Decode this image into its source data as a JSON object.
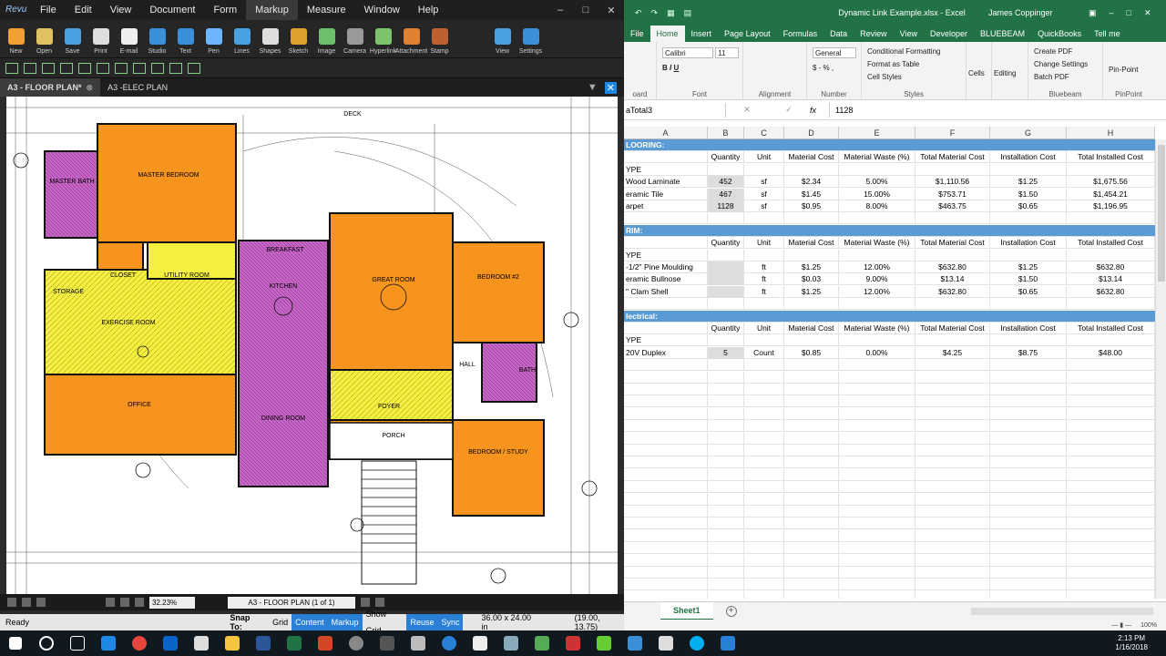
{
  "bluebeam": {
    "menu": [
      "File",
      "Edit",
      "View",
      "Document",
      "Form",
      "Markup",
      "Measure",
      "Window",
      "Help"
    ],
    "active_menu": "Markup",
    "logo": "Revu",
    "tools": [
      {
        "label": "New",
        "color": "#f0a030"
      },
      {
        "label": "Open",
        "color": "#e0c060"
      },
      {
        "label": "Save",
        "color": "#4aa0e0"
      },
      {
        "label": "Print",
        "color": "#dddddd"
      },
      {
        "label": "E-mail",
        "color": "#eeeeee"
      },
      {
        "label": "Studio",
        "color": "#3b8fd8"
      },
      {
        "label": "Text",
        "color": "#3b8fd8"
      },
      {
        "label": "Pen",
        "color": "#6cb6ff"
      },
      {
        "label": "Lines",
        "color": "#4aa0e0"
      },
      {
        "label": "Shapes",
        "color": "#dddddd"
      },
      {
        "label": "Sketch",
        "color": "#e0a030"
      },
      {
        "label": "Image",
        "color": "#6cbf6c"
      },
      {
        "label": "Camera",
        "color": "#999999"
      },
      {
        "label": "Hyperlink",
        "color": "#7cc36c"
      },
      {
        "label": "Attachment",
        "color": "#e08030"
      },
      {
        "label": "Stamp",
        "color": "#c06030"
      },
      {
        "label": "View",
        "color": "#4aa0e0"
      },
      {
        "label": "Settings",
        "color": "#3b8fd8"
      }
    ],
    "tabs": [
      {
        "label": "A3 - FLOOR PLAN*",
        "active": true
      },
      {
        "label": "A3 -ELEC PLAN",
        "active": false
      }
    ],
    "nav": {
      "zoom": "32.23%",
      "page": "A3 - FLOOR PLAN (1 of 1)"
    },
    "status": {
      "ready": "Ready",
      "snap_label": "Snap To:",
      "buttons": [
        {
          "label": "Grid",
          "on": false
        },
        {
          "label": "Content",
          "on": true
        },
        {
          "label": "Markup",
          "on": true
        },
        {
          "label": "Show Grid",
          "on": false
        },
        {
          "label": "Reuse",
          "on": true
        },
        {
          "label": "Sync",
          "on": true
        }
      ],
      "dimensions": "36.00 x 24.00 in",
      "coords": "(19.00, 13.75)"
    },
    "plan": {
      "rooms": [
        "MASTER BEDROOM",
        "MASTER BATH",
        "CLOSET",
        "UTILITY ROOM",
        "STORAGE",
        "EXERCISE ROOM",
        "OFFICE",
        "BREAKFAST",
        "KITCHEN",
        "DINING ROOM",
        "GREAT ROOM",
        "BEDROOM #2",
        "BATH",
        "HALL",
        "FOYER",
        "PORCH",
        "BEDROOM / STUDY",
        "DECK"
      ],
      "colors": {
        "orange": "#f7941d",
        "purple": "#cc66cc",
        "yellow": "#f5f040"
      }
    }
  },
  "excel": {
    "title": "Dynamic Link Example.xlsx - Excel",
    "user": "James Coppinger",
    "ribbon_tabs": [
      "File",
      "Home",
      "Insert",
      "Page Layout",
      "Formulas",
      "Data",
      "Review",
      "View",
      "Developer",
      "BLUEBEAM",
      "QuickBooks",
      "Tell me"
    ],
    "active_tab": "Home",
    "ribbon": {
      "font_name": "Calibri",
      "font_size": "11",
      "number_format": "General",
      "styles": [
        "Conditional Formatting",
        "Format as Table",
        "Cell Styles"
      ],
      "bluebeam": [
        "Create PDF",
        "Change Settings",
        "Batch PDF"
      ],
      "cells": "Cells",
      "editing": "Editing",
      "pinpoint": "Pin-Point",
      "groups": [
        "oard",
        "Font",
        "Alignment",
        "Number",
        "Styles",
        "Bluebeam",
        "PinPoint"
      ]
    },
    "name_box": "aTotal3",
    "formula": "1128",
    "columns": [
      "A",
      "B",
      "C",
      "D",
      "E",
      "F",
      "G",
      "H"
    ],
    "headers": [
      "Quantity",
      "Unit",
      "Material Cost",
      "Material Waste (%)",
      "Total Material Cost",
      "Installation Cost",
      "Total Installed Cost"
    ],
    "sections": [
      {
        "title": "LOORING:",
        "type_label": "YPE",
        "items": [
          {
            "name": "Wood Laminate",
            "qty": "452",
            "unit": "sf",
            "mcost": "$2.34",
            "waste": "5.00%",
            "tmc": "$1,110.56",
            "icost": "$1.25",
            "tic": "$1,675.56"
          },
          {
            "name": "eramic Tile",
            "qty": "467",
            "unit": "sf",
            "mcost": "$1.45",
            "waste": "15.00%",
            "tmc": "$753.71",
            "icost": "$1.50",
            "tic": "$1,454.21"
          },
          {
            "name": "arpet",
            "qty": "1128",
            "unit": "sf",
            "mcost": "$0.95",
            "waste": "8.00%",
            "tmc": "$463.75",
            "icost": "$0.65",
            "tic": "$1,196.95"
          }
        ]
      },
      {
        "title": "RIM:",
        "type_label": "YPE",
        "items": [
          {
            "name": "-1/2\" Pine Moulding",
            "qty": "",
            "unit": "ft",
            "mcost": "$1.25",
            "waste": "12.00%",
            "tmc": "$632.80",
            "icost": "$1.25",
            "tic": "$632.80"
          },
          {
            "name": "eramic Bullnose",
            "qty": "",
            "unit": "ft",
            "mcost": "$0.03",
            "waste": "9.00%",
            "tmc": "$13.14",
            "icost": "$1.50",
            "tic": "$13.14"
          },
          {
            "name": "\" Clam Shell",
            "qty": "",
            "unit": "ft",
            "mcost": "$1.25",
            "waste": "12.00%",
            "tmc": "$632.80",
            "icost": "$0.65",
            "tic": "$632.80"
          }
        ]
      },
      {
        "title": "lectrical:",
        "type_label": "YPE",
        "items": [
          {
            "name": "20V Duplex",
            "qty": "5",
            "unit": "Count",
            "mcost": "$0.85",
            "waste": "0.00%",
            "tmc": "$4.25",
            "icost": "$8.75",
            "tic": "$48.00"
          }
        ]
      }
    ],
    "sheet": "Sheet1",
    "zoom": "100%"
  },
  "taskbar": {
    "time": "2:13 PM",
    "date": "1/16/2018"
  }
}
